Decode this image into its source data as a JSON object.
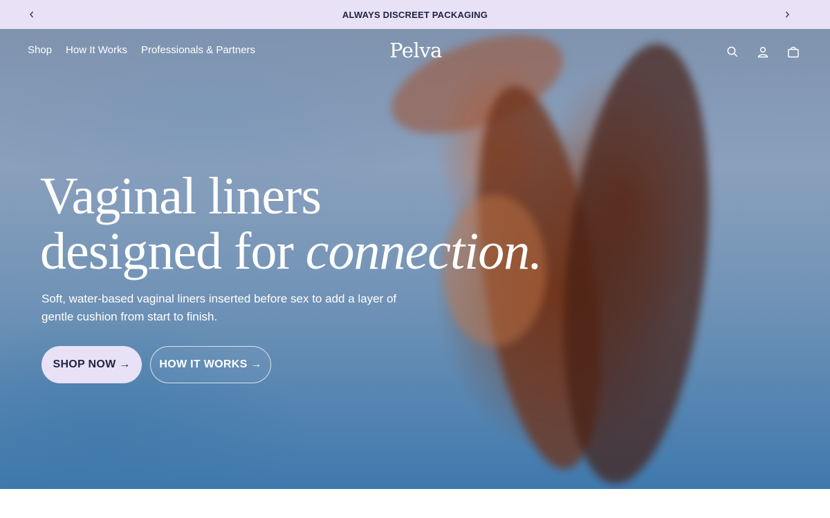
{
  "announcement": {
    "text": "ALWAYS DISCREET PACKAGING",
    "prev_icon": "chevron-left-icon",
    "next_icon": "chevron-right-icon"
  },
  "nav": {
    "links": [
      "Shop",
      "How It Works",
      "Professionals & Partners"
    ],
    "logo": "Pelva",
    "icons": [
      "search-icon",
      "account-icon",
      "cart-icon"
    ]
  },
  "hero": {
    "headline_line1": "Vaginal liners",
    "headline_line2_plain": "designed for ",
    "headline_line2_italic": "connection.",
    "subtext": "Soft, water-based vaginal liners inserted before sex to add a layer of gentle cushion from start to finish.",
    "primary_button": "SHOP NOW →",
    "secondary_button": "HOW IT WORKS →"
  },
  "colors": {
    "announcement_bg": "#e9e1f5",
    "announcement_text": "#1d2340",
    "primary_button_bg": "#e9e1f5"
  }
}
